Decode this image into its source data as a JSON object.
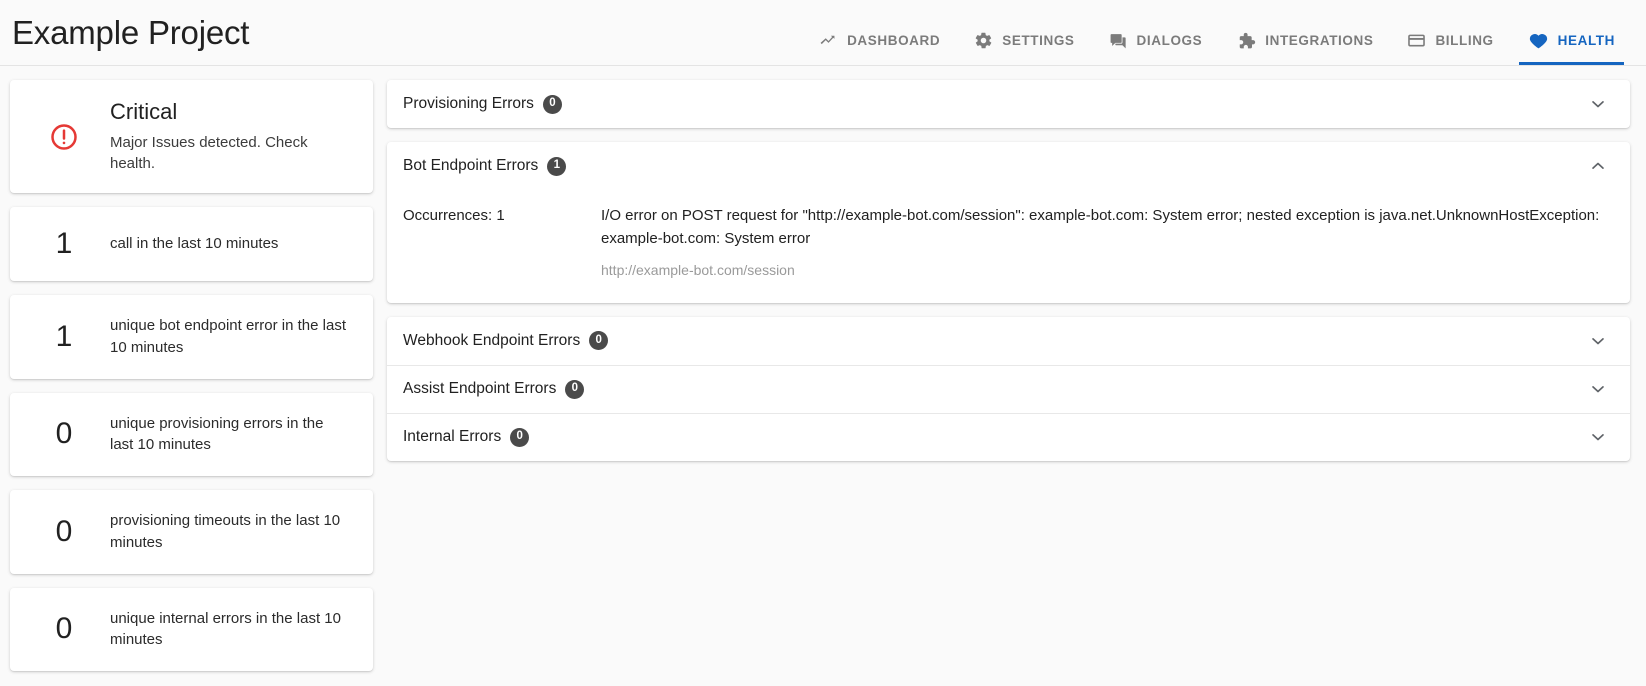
{
  "header": {
    "title": "Example Project",
    "nav": [
      {
        "label": "DASHBOARD",
        "icon": "trending-up-icon",
        "active": false
      },
      {
        "label": "SETTINGS",
        "icon": "gear-icon",
        "active": false
      },
      {
        "label": "DIALOGS",
        "icon": "chat-icon",
        "active": false
      },
      {
        "label": "INTEGRATIONS",
        "icon": "puzzle-icon",
        "active": false
      },
      {
        "label": "BILLING",
        "icon": "credit-card-icon",
        "active": false
      },
      {
        "label": "HEALTH",
        "icon": "heart-icon",
        "active": true
      }
    ],
    "active_color": "#1565c0",
    "inactive_color": "#7b7b7b"
  },
  "status": {
    "icon": "error-circle-icon",
    "icon_color": "#e53935",
    "title": "Critical",
    "description": "Major Issues detected. Check health."
  },
  "metrics": [
    {
      "value": "1",
      "label": "call in the last 10 minutes"
    },
    {
      "value": "1",
      "label": "unique bot endpoint error in the last 10 minutes"
    },
    {
      "value": "0",
      "label": "unique provisioning errors in the last 10 minutes"
    },
    {
      "value": "0",
      "label": "provisioning timeouts in the last 10 minutes"
    },
    {
      "value": "0",
      "label": "unique internal errors in the last 10 minutes"
    }
  ],
  "panels": {
    "provisioning": {
      "title": "Provisioning Errors",
      "badge": "0",
      "expanded": false,
      "chevron": "chevron-down-icon"
    },
    "bot": {
      "title": "Bot Endpoint Errors",
      "badge": "1",
      "expanded": true,
      "chevron": "chevron-up-icon",
      "occurrences_label": "Occurrences: 1",
      "message": "I/O error on POST request for \"http://example-bot.com/session\": example-bot.com: System error; nested exception is java.net.UnknownHostException: example-bot.com: System error",
      "url": "http://example-bot.com/session"
    },
    "webhook": {
      "title": "Webhook Endpoint Errors",
      "badge": "0",
      "expanded": false,
      "chevron": "chevron-down-icon"
    },
    "assist": {
      "title": "Assist Endpoint Errors",
      "badge": "0",
      "expanded": false,
      "chevron": "chevron-down-icon"
    },
    "internal": {
      "title": "Internal Errors",
      "badge": "0",
      "expanded": false,
      "chevron": "chevron-down-icon"
    }
  }
}
